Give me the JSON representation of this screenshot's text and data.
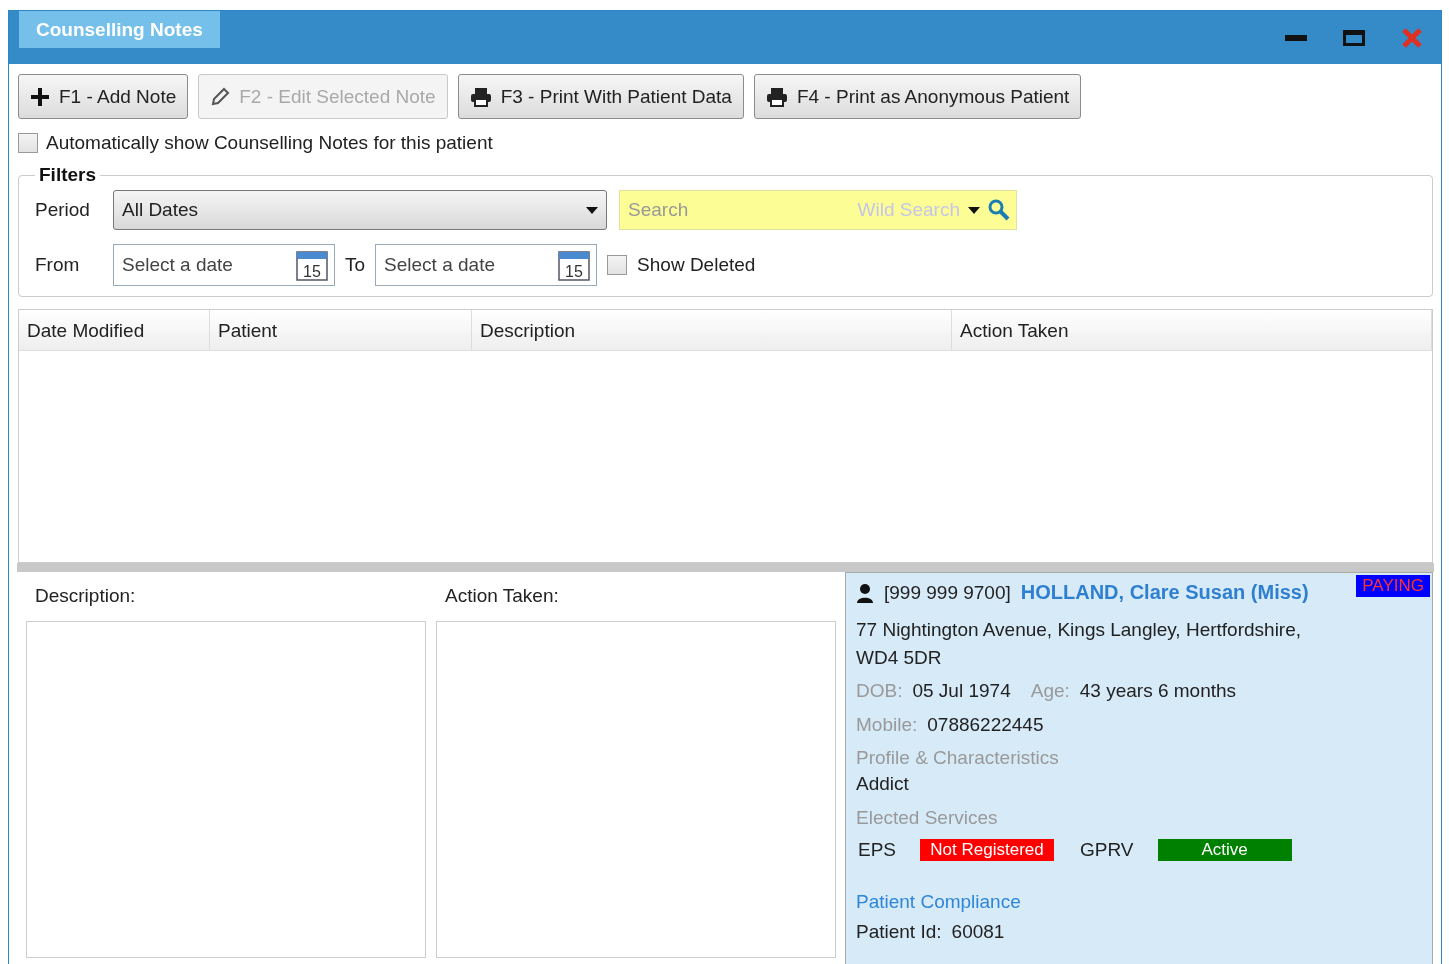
{
  "window": {
    "title": "Counselling Notes"
  },
  "toolbar": [
    {
      "kind": "add",
      "label": "F1 - Add Note",
      "disabled": false
    },
    {
      "kind": "edit",
      "label": "F2 - Edit Selected Note",
      "disabled": true
    },
    {
      "kind": "print",
      "label": "F3 - Print With Patient Data",
      "disabled": false
    },
    {
      "kind": "print",
      "label": "F4 - Print as Anonymous Patient",
      "disabled": false
    }
  ],
  "auto_show": {
    "label": "Automatically show Counselling Notes for this patient",
    "checked": false
  },
  "filters": {
    "legend": "Filters",
    "period_label": "Period",
    "period_value": "All Dates",
    "search": {
      "placeholder": "Search",
      "mode": "Wild Search"
    },
    "from_label": "From",
    "from_placeholder": "Select a date",
    "from_calendar_day": "15",
    "to_label": "To",
    "to_placeholder": "Select a date",
    "to_calendar_day": "15",
    "show_deleted": {
      "label": "Show Deleted",
      "checked": false
    }
  },
  "table": {
    "columns": [
      "Date Modified",
      "Patient",
      "Description",
      "Action Taken"
    ]
  },
  "details": {
    "description_label": "Description:",
    "action_label": "Action Taken:"
  },
  "patient": {
    "nhs_number": "[999 999 9700]",
    "name": "HOLLAND, Clare Susan (Miss)",
    "badge": "PAYING",
    "address": "77 Nightington Avenue, Kings Langley, Hertfordshire, WD4 5DR",
    "dob_label": "DOB:",
    "dob": "05 Jul 1974",
    "age_label": "Age:",
    "age": "43 years 6 months",
    "mobile_label": "Mobile:",
    "mobile": "07886222445",
    "profile_heading": "Profile & Characteristics",
    "profile_value": "Addict",
    "services_heading": "Elected Services",
    "services": [
      {
        "name": "EPS",
        "status": "Not Registered",
        "color": "#ff0000"
      },
      {
        "name": "GPRV",
        "status": "Active",
        "color": "#008000"
      }
    ],
    "compliance_link": "Patient Compliance",
    "id_label": "Patient Id:",
    "id": "60081"
  }
}
